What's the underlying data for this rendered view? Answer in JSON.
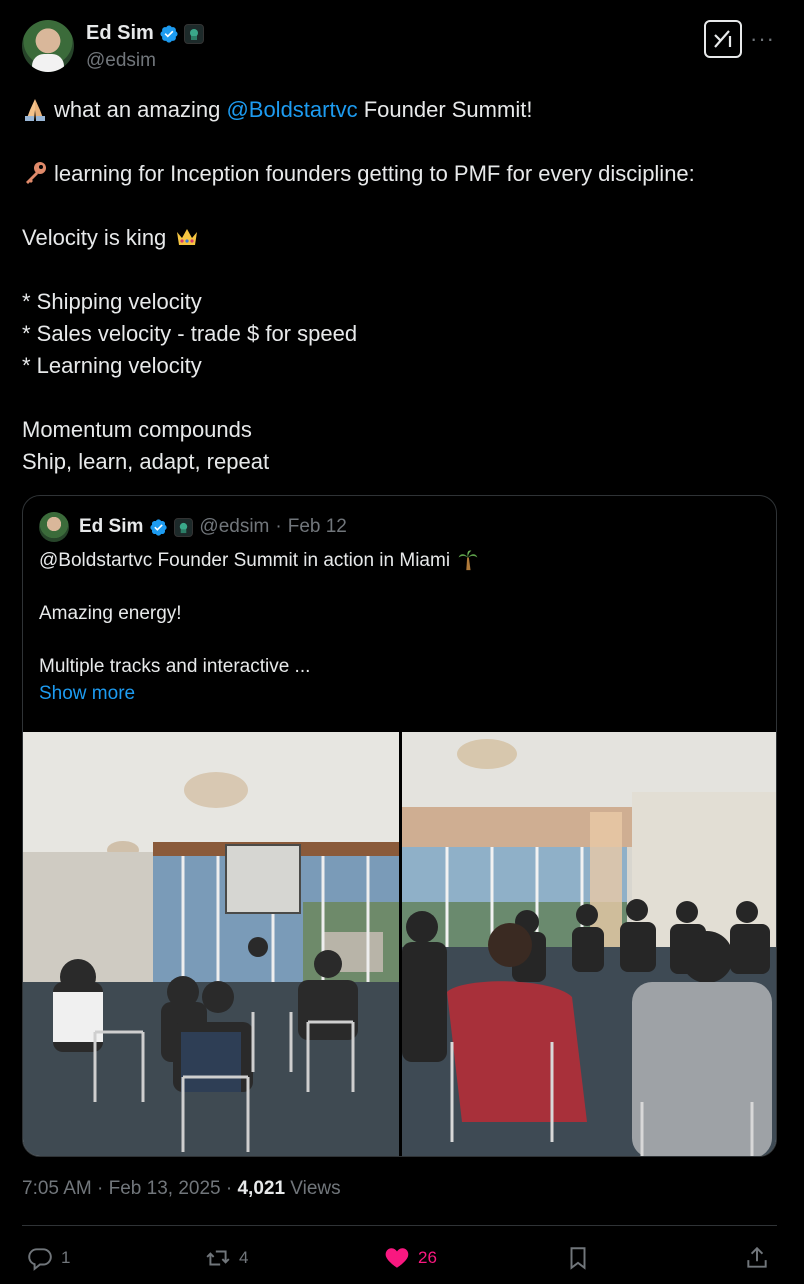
{
  "author": {
    "name": "Ed Sim",
    "handle": "@edsim",
    "verified": true,
    "avatar_icon": "avatar"
  },
  "tweet": {
    "lines": [
      {
        "emoji": "folded-hands",
        "before": "what an amazing ",
        "mention": "@Boldstartvc",
        "after": " Founder Summit!"
      },
      {
        "text": ""
      },
      {
        "emoji": "key",
        "text": "learning for Inception founders getting to PMF for every discipline:"
      },
      {
        "text": ""
      },
      {
        "text": "Velocity is king",
        "emoji_after": "crown"
      },
      {
        "text": ""
      },
      {
        "text": "* Shipping velocity"
      },
      {
        "text": "* Sales velocity - trade $ for speed"
      },
      {
        "text": "* Learning velocity"
      },
      {
        "text": ""
      },
      {
        "text": "Momentum compounds"
      },
      {
        "text": "Ship, learn, adapt, repeat"
      }
    ]
  },
  "quoted": {
    "name": "Ed Sim",
    "handle": "@edsim",
    "separator": "·",
    "date": "Feb 12",
    "line1": "@Boldstartvc Founder Summit in action in Miami",
    "line1_emoji": "palm-tree",
    "line2": "Amazing energy!",
    "line3": "Multiple tracks and interactive ...",
    "show_more": "Show more",
    "photos": [
      "conference-room-photo",
      "breakout-circle-photo"
    ]
  },
  "meta": {
    "time": "7:05 AM",
    "sep1": " · ",
    "date": "Feb 13, 2025",
    "sep2": " · ",
    "views_count": "4,021",
    "views_label": " Views"
  },
  "actions": {
    "replies": "1",
    "reposts": "4",
    "likes": "26",
    "like_color": "#f91880",
    "accent": "#1d9bf0"
  }
}
